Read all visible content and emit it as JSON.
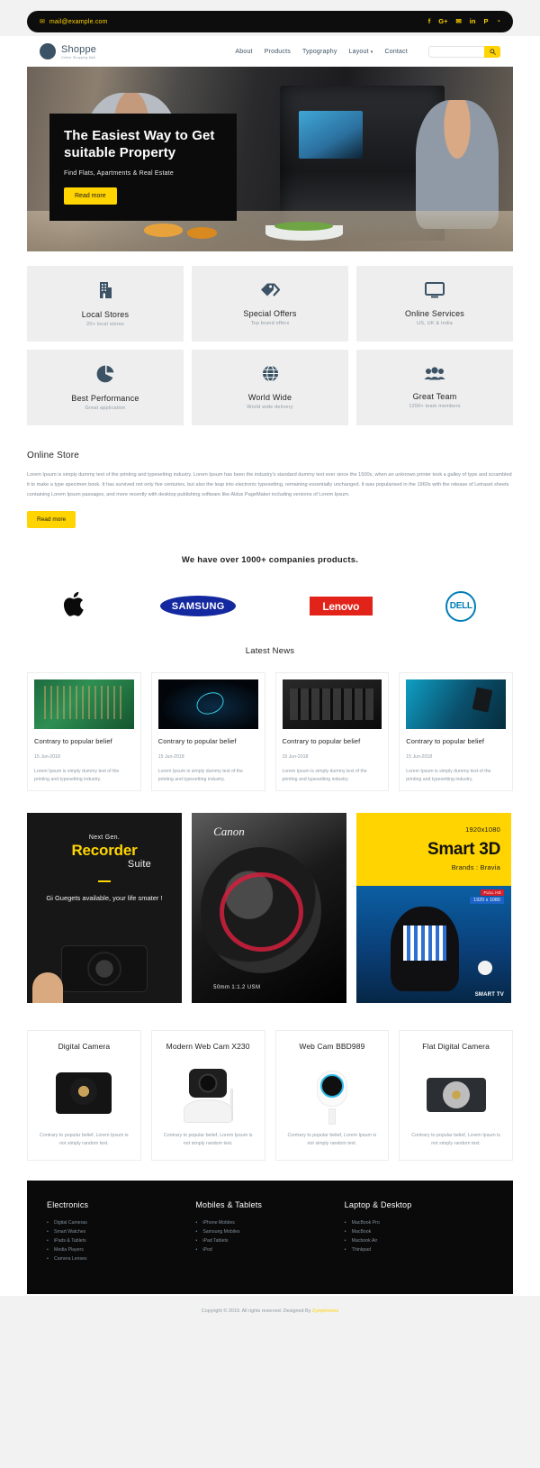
{
  "topbar": {
    "email": "mail@example.com",
    "mail_icon": "envelope-icon",
    "socials": [
      {
        "name": "facebook-icon",
        "glyph": "f"
      },
      {
        "name": "google-plus-icon",
        "glyph": "G+"
      },
      {
        "name": "twitter-icon",
        "glyph": "✉"
      },
      {
        "name": "linkedin-icon",
        "glyph": "in"
      },
      {
        "name": "pinterest-icon",
        "glyph": "P"
      },
      {
        "name": "rss-icon",
        "glyph": "◔"
      }
    ]
  },
  "header": {
    "brand_name": "Shoppe",
    "brand_tagline": "Online Shopping Mall",
    "nav": [
      {
        "label": "About",
        "has_caret": false
      },
      {
        "label": "Products",
        "has_caret": false
      },
      {
        "label": "Typography",
        "has_caret": false
      },
      {
        "label": "Layout",
        "has_caret": true
      },
      {
        "label": "Contact",
        "has_caret": false
      }
    ],
    "search_placeholder": "",
    "search_value": "",
    "search_icon": "search-icon"
  },
  "hero": {
    "title": "The Easiest Way to Get suitable Property",
    "subtitle": "Find Flats, Apartments & Real Estate",
    "button": "Read more"
  },
  "features": [
    {
      "icon": "building-icon",
      "glyph": "🏢",
      "title": "Local Stores",
      "sub": "20+ local stores"
    },
    {
      "icon": "tags-icon",
      "glyph": "🏷",
      "title": "Special Offers",
      "sub": "Top brand offers"
    },
    {
      "icon": "monitor-icon",
      "glyph": "🖥",
      "title": "Online Services",
      "sub": "US, UK & India"
    },
    {
      "icon": "pie-chart-icon",
      "glyph": "◔",
      "title": "Best Performance",
      "sub": "Great application"
    },
    {
      "icon": "globe-icon",
      "glyph": "🌐",
      "title": "World Wide",
      "sub": "World wide delivery"
    },
    {
      "icon": "users-icon",
      "glyph": "👥",
      "title": "Great Team",
      "sub": "1200+ team members"
    }
  ],
  "store": {
    "heading": "Online Store",
    "paragraph": "Lorem Ipsum is simply dummy text of the printing and typesetting industry. Lorem Ipsum has been the industry's standard dummy text ever since the 1500s, when an unknown printer took a galley of type and scrambled it to make a type specimen book. It has survived not only five centuries, but also the leap into electronic typesetting, remaining essentially unchanged. It was popularised in the 1960s with the release of Letraset sheets containing Lorem Ipsum passages, and more recently with desktop publishing software like Aldus PageMaker including versions of Lorem Ipsum.",
    "button": "Read more"
  },
  "brands": {
    "heading": "We have over 1000+ companies products.",
    "items": [
      {
        "name": "apple-logo",
        "label": ""
      },
      {
        "name": "samsung-logo",
        "label": "SAMSUNG"
      },
      {
        "name": "lenovo-logo",
        "label": "Lenovo"
      },
      {
        "name": "dell-logo",
        "label": "DELL"
      }
    ]
  },
  "news": {
    "heading": "Latest News",
    "items": [
      {
        "title": "Contrary to popular belief",
        "date": "15 Jun-2018",
        "body": "Lorem Ipsum is simply dummy text of the printing and typesetting industry."
      },
      {
        "title": "Contrary to popular belief",
        "date": "15 Jun-2018",
        "body": "Lorem Ipsum is simply dummy text of the printing and typesetting industry."
      },
      {
        "title": "Contrary to popular belief",
        "date": "15 Jun-2018",
        "body": "Lorem Ipsum is simply dummy text of the printing and typesetting industry."
      },
      {
        "title": "Contrary to popular belief",
        "date": "15 Jun-2018",
        "body": "Lorem Ipsum is simply dummy text of the printing and typesetting industry."
      }
    ]
  },
  "promos": {
    "recorder": {
      "kicker": "Next Gen.",
      "title": "Recorder",
      "subtitle": "Suite",
      "line": "Gi Guegets available, your life smater !"
    },
    "camera": {
      "brand": "Canon",
      "spec": "50mm  1:1.2            USM"
    },
    "smarttv": {
      "resolution": "1920x1080",
      "title": "Smart 3D",
      "brand": "Brands : Bravia",
      "badge_hd": "FULL HD",
      "badge_3d": "1920 x 1080",
      "badge_smart": "SMART TV"
    }
  },
  "products": [
    {
      "title": "Digital Camera",
      "body": "Contrary to popular belief, Lorem Ipsum is not simply random text."
    },
    {
      "title": "Modern Web Cam X230",
      "body": "Contrary to popular belief, Lorem Ipsum is not simply random text."
    },
    {
      "title": "Web Cam BBD989",
      "body": "Contrary to popular belief, Lorem Ipsum is not simply random text."
    },
    {
      "title": "Flat Digital Camera",
      "body": "Contrary to popular belief, Lorem Ipsum is not simply random text."
    }
  ],
  "footer": {
    "columns": [
      {
        "heading": "Electronics",
        "links": [
          "Digital Cameras",
          "Smart Watches",
          "iPads & Tablets",
          "Media Players",
          "Camera Lenses"
        ]
      },
      {
        "heading": "Mobiles & Tablets",
        "links": [
          "iPhone Mobiles",
          "Samsung Mobiles",
          "iPad Tablets",
          "iPod"
        ]
      },
      {
        "heading": "Laptop & Desktop",
        "links": [
          "MacBook Pro",
          "MacBook",
          "Macbook Air",
          "Thinkpad"
        ]
      }
    ],
    "copyright_prefix": "Copyright © 2019. All rights reserved. Designed By ",
    "copyright_brand": "Zymphonies"
  },
  "colors": {
    "accent": "#ffd400",
    "dark": "#0a0a0a",
    "slate": "#3c5365",
    "muted": "#8d9aa5"
  }
}
